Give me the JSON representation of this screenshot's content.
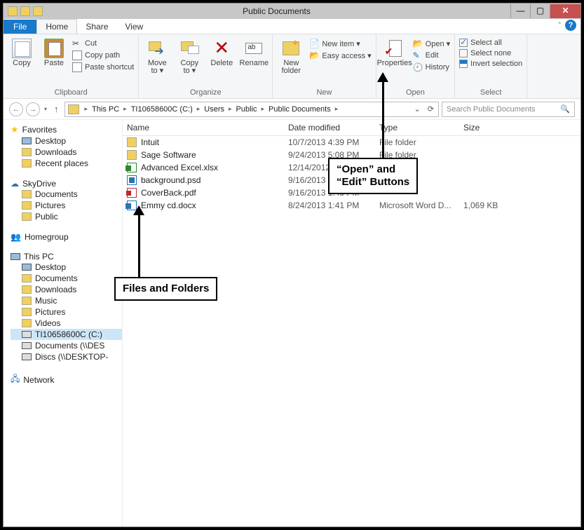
{
  "window": {
    "title": "Public Documents"
  },
  "tabs": {
    "file": "File",
    "home": "Home",
    "share": "Share",
    "view": "View"
  },
  "ribbon": {
    "clipboard": {
      "copy": "Copy",
      "paste": "Paste",
      "cut": "Cut",
      "copypath": "Copy path",
      "shortcut": "Paste shortcut",
      "label": "Clipboard"
    },
    "organize": {
      "moveto": "Move\nto ▾",
      "copyto": "Copy\nto ▾",
      "delete": "Delete",
      "rename": "Rename",
      "label": "Organize"
    },
    "new": {
      "newfolder": "New\nfolder",
      "newitem": "New item ▾",
      "easy": "Easy access ▾",
      "label": "New"
    },
    "open": {
      "properties": "Properties",
      "open": "Open ▾",
      "edit": "Edit",
      "history": "History",
      "label": "Open"
    },
    "select": {
      "all": "Select all",
      "none": "Select none",
      "invert": "Invert selection",
      "label": "Select"
    }
  },
  "breadcrumb": [
    "This PC",
    "TI10658600C (C:)",
    "Users",
    "Public",
    "Public Documents"
  ],
  "search": {
    "placeholder": "Search Public Documents"
  },
  "columns": {
    "name": "Name",
    "date": "Date modified",
    "type": "Type",
    "size": "Size"
  },
  "sidebar": {
    "favorites": {
      "label": "Favorites",
      "items": [
        "Desktop",
        "Downloads",
        "Recent places"
      ]
    },
    "skydrive": {
      "label": "SkyDrive",
      "items": [
        "Documents",
        "Pictures",
        "Public"
      ]
    },
    "homegroup": {
      "label": "Homegroup"
    },
    "thispc": {
      "label": "This PC",
      "items": [
        "Desktop",
        "Documents",
        "Downloads",
        "Music",
        "Pictures",
        "Videos",
        "TI10658600C (C:)",
        "Documents (\\\\DES",
        "Discs (\\\\DESKTOP-"
      ]
    },
    "network": {
      "label": "Network"
    }
  },
  "files": [
    {
      "name": "Intuit",
      "date": "10/7/2013 4:39 PM",
      "type": "File folder",
      "size": "",
      "icon": "fi-folder"
    },
    {
      "name": "Sage Software",
      "date": "9/24/2013 5:08 PM",
      "type": "File folder",
      "size": "",
      "icon": "fi-folder"
    },
    {
      "name": "Advanced Excel.xlsx",
      "date": "12/14/2012 1:45 PM",
      "type": "",
      "size": "",
      "icon": "fi-xls"
    },
    {
      "name": "background.psd",
      "date": "9/16/2013 3:18 PM",
      "type": "",
      "size": "",
      "icon": "fi-psd"
    },
    {
      "name": "CoverBack.pdf",
      "date": "9/16/2013 1:45 PM",
      "type": "",
      "size": "",
      "icon": "fi-pdf"
    },
    {
      "name": "Emmy cd.docx",
      "date": "8/24/2013 1:41 PM",
      "type": "Microsoft Word D...",
      "size": "1,069 KB",
      "icon": "fi-doc"
    }
  ],
  "callouts": {
    "openEdit": "“Open” and\n“Edit” Buttons",
    "files": "Files and Folders"
  }
}
